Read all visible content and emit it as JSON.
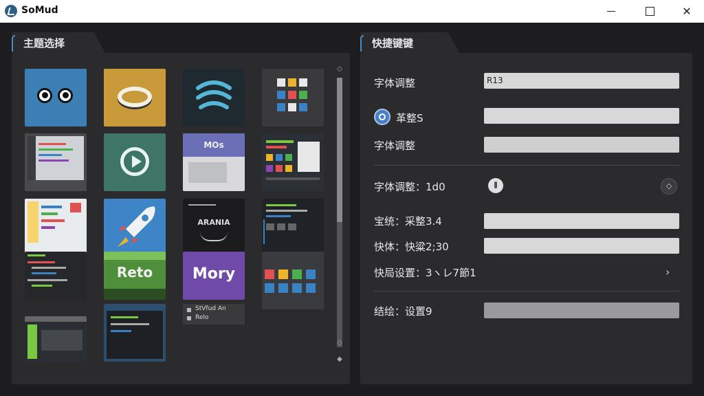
{
  "window": {
    "title": "SoMud"
  },
  "left_panel": {
    "tab_label": "主题选择",
    "thumbnails": [
      {
        "label": "",
        "bg": "#3b7fb5"
      },
      {
        "label": "",
        "bg": "#c99a3a"
      },
      {
        "label": "",
        "bg": "#1e2a30"
      },
      {
        "label": "",
        "bg": "#3a3a3d"
      },
      {
        "label": "",
        "bg": "#4a4a4d"
      },
      {
        "label": "",
        "bg": "#3e7564"
      },
      {
        "label": "MOs",
        "bg": "#d9d9dd"
      },
      {
        "label": "",
        "bg": "#2b2f36"
      },
      {
        "label": "",
        "bg": "#e9ecef"
      },
      {
        "label": "",
        "bg": "#3d85c6"
      },
      {
        "label": "ARANIA",
        "bg": "#1b1b1d"
      },
      {
        "label": "",
        "bg": "#1f2328"
      },
      {
        "label": "",
        "bg": "#25272b"
      },
      {
        "label": "Reto",
        "bg": "#4f8f3c"
      },
      {
        "label": "Mory",
        "bg": "#6f4aa8"
      },
      {
        "label": "",
        "bg": "#3a3b3e"
      },
      {
        "label": "",
        "bg": "#2a2d31"
      },
      {
        "label": "",
        "bg": "#2c4f6e"
      },
      {
        "label": "StVfud An",
        "bg": "#3a3a3c"
      }
    ],
    "thumb_texts": [
      "MOs",
      "ARANIA",
      "Reto",
      "Mory",
      "StVfud An",
      "Relo"
    ]
  },
  "right_panel": {
    "tab_label": "快捷键键",
    "rows": [
      {
        "label": "字体调整",
        "value": "R13"
      },
      {
        "label": "革整S",
        "value": ""
      },
      {
        "label": "字体调整",
        "value": ""
      },
      {
        "label": "字体调整：1d0"
      },
      {
        "label": "宝统：采整3.4",
        "value": ""
      },
      {
        "label": "快体：快粱2;30",
        "value": ""
      },
      {
        "label": "快局设置：3ヽレ7節1"
      },
      {
        "label": "结绘：设置9",
        "value": ""
      }
    ]
  }
}
